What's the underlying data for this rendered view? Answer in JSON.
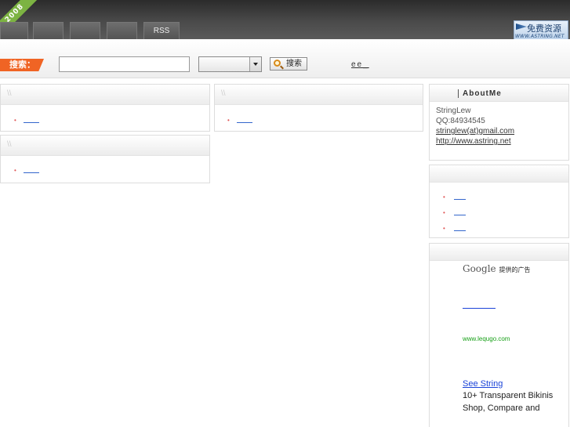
{
  "header": {
    "ribbon_label": "2008",
    "nav_tabs": [
      "",
      "",
      "",
      "",
      "RSS"
    ],
    "logo": {
      "cn_text": "免费资源",
      "url_text": "WWW.ASTRING.NET"
    }
  },
  "search": {
    "label": "搜索：",
    "input_value": "",
    "select_value": "",
    "button_label": "搜索",
    "extra_link": "ee_"
  },
  "panels": [
    {
      "slash": "\\\\",
      "items": [
        ""
      ]
    },
    {
      "slash": "\\\\",
      "items": [
        ""
      ]
    },
    {
      "slash": "\\\\",
      "items": [
        ""
      ]
    }
  ],
  "sidebar": {
    "about": {
      "title": "AboutMe",
      "name": "StringLew",
      "qq": "QQ:84934545",
      "email": "stringlew(at)gmail.com",
      "website": "http://www.astring.net"
    },
    "links": {
      "items": [
        "",
        "",
        ""
      ]
    },
    "ads": {
      "google": "Google",
      "google_suffix": "提供的广告",
      "first_link": "",
      "url": "www.lequgo.com",
      "ad_title": "See String",
      "ad_body": "10+ Transparent Bikinis Shop, Compare and"
    }
  },
  "colors": {
    "accent": "#f06424",
    "bullet": "#e05555",
    "link": "#1a43d8",
    "url_green": "#18a018",
    "ribbon": "#7cb342"
  }
}
